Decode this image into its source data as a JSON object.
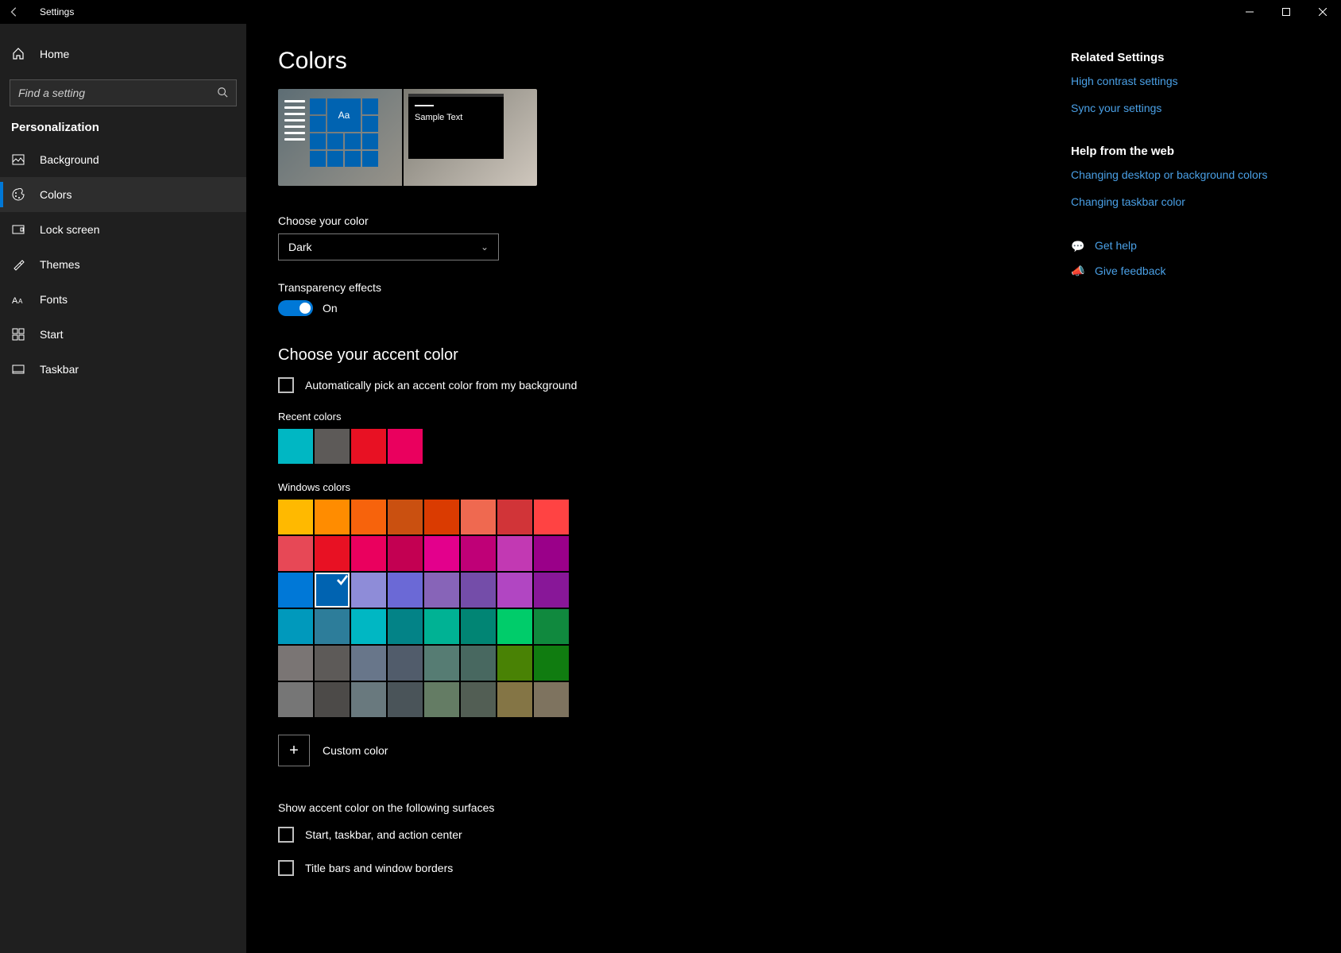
{
  "titlebar": {
    "title": "Settings"
  },
  "sidebar": {
    "home": "Home",
    "search_placeholder": "Find a setting",
    "category": "Personalization",
    "items": [
      {
        "label": "Background"
      },
      {
        "label": "Colors"
      },
      {
        "label": "Lock screen"
      },
      {
        "label": "Themes"
      },
      {
        "label": "Fonts"
      },
      {
        "label": "Start"
      },
      {
        "label": "Taskbar"
      }
    ]
  },
  "page": {
    "title": "Colors",
    "preview_tile_text": "Aa",
    "preview_sample_text": "Sample Text",
    "choose_color_label": "Choose your color",
    "color_mode_value": "Dark",
    "transparency_label": "Transparency effects",
    "transparency_value": "On",
    "accent_heading": "Choose your accent color",
    "auto_pick_label": "Automatically pick an accent color from my background",
    "recent_label": "Recent colors",
    "recent_colors": [
      "#00b7c3",
      "#5d5a58",
      "#e81123",
      "#ea005e"
    ],
    "windows_label": "Windows colors",
    "windows_colors": [
      "#ffb900",
      "#ff8c00",
      "#f7630c",
      "#ca5010",
      "#da3b01",
      "#ef6950",
      "#d13438",
      "#ff4343",
      "#e74856",
      "#e81123",
      "#ea005e",
      "#c30052",
      "#e3008c",
      "#bf0077",
      "#c239b3",
      "#9a0089",
      "#0078d7",
      "#0063b1",
      "#8e8cd8",
      "#6b69d6",
      "#8764b8",
      "#744da9",
      "#b146c2",
      "#881798",
      "#0099bc",
      "#2d7d9a",
      "#00b7c3",
      "#038387",
      "#00b294",
      "#018574",
      "#00cc6a",
      "#10893e",
      "#7a7574",
      "#5d5a58",
      "#68768a",
      "#515c6b",
      "#567c73",
      "#486860",
      "#498205",
      "#107c10",
      "#767676",
      "#4c4a48",
      "#69797e",
      "#4a5459",
      "#647c64",
      "#525e54",
      "#847545",
      "#7e735f"
    ],
    "selected_color_index": 17,
    "custom_color_label": "Custom color",
    "surfaces_heading": "Show accent color on the following surfaces",
    "surface1": "Start, taskbar, and action center",
    "surface2": "Title bars and window borders"
  },
  "related": {
    "heading": "Related Settings",
    "links": [
      "High contrast settings",
      "Sync your settings"
    ]
  },
  "help": {
    "heading": "Help from the web",
    "links": [
      "Changing desktop or background colors",
      "Changing taskbar color"
    ]
  },
  "support": {
    "get_help": "Get help",
    "feedback": "Give feedback"
  }
}
